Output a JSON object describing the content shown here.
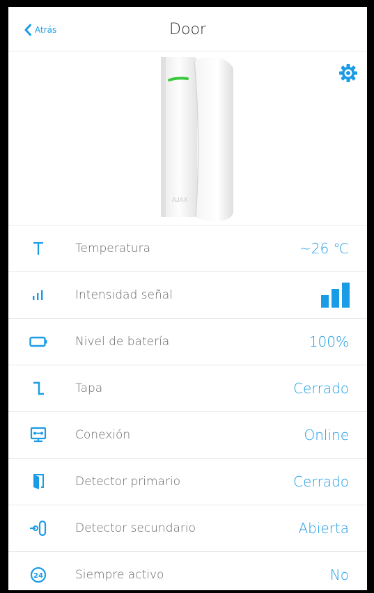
{
  "header": {
    "back_label": "Atrás",
    "title": "Door"
  },
  "hero": {
    "device_brand": "AJAX"
  },
  "rows": [
    {
      "icon": "temperature-icon",
      "label": "Temperatura",
      "value": "~26 ℃"
    },
    {
      "icon": "signal-strength-icon",
      "label": "Intensidad señal",
      "value": "",
      "signal_level_fraction": 1.0
    },
    {
      "icon": "battery-icon",
      "label": "Nivel de batería",
      "value": "100%"
    },
    {
      "icon": "tamper-lid-icon",
      "label": "Tapa",
      "value": "Cerrado"
    },
    {
      "icon": "connection-icon",
      "label": "Conexión",
      "value": "Online"
    },
    {
      "icon": "door-primary-icon",
      "label": "Detector primario",
      "value": "Cerrado"
    },
    {
      "icon": "secondary-detector-icon",
      "label": "Detector secundario",
      "value": "Abierta"
    },
    {
      "icon": "always-active-24-icon",
      "label": "Siempre activo",
      "value": "No"
    }
  ],
  "colors": {
    "accent": "#1a9be6",
    "frame": "#000000"
  }
}
